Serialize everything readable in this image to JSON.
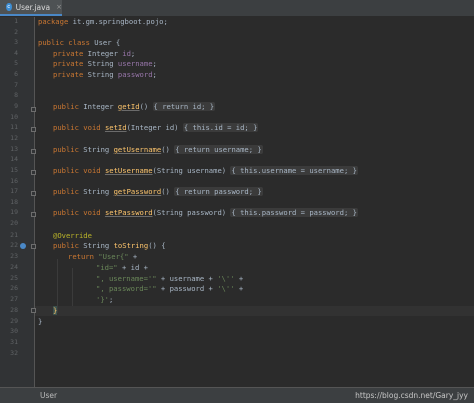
{
  "tab": {
    "label": "User.java",
    "icon": "c-class-icon",
    "close": "×"
  },
  "code": {
    "package": [
      "package",
      " it.gm.springboot.pojo;"
    ],
    "class_decl": [
      "public",
      " ",
      "class",
      " User {"
    ],
    "field1": [
      "private",
      " Integer ",
      "id",
      ";"
    ],
    "field2": [
      "private",
      " String ",
      "username",
      ";"
    ],
    "field3": [
      "private",
      " String ",
      "password",
      ";"
    ],
    "getId": [
      "public",
      " Integer ",
      "getId",
      "() ",
      "{ return id; }"
    ],
    "setId": [
      "public",
      " ",
      "void",
      " ",
      "setId",
      "(Integer id) ",
      "{ this.id = id; }"
    ],
    "getUsername": [
      "public",
      " String ",
      "getUsername",
      "() ",
      "{ return username; }"
    ],
    "setUsername": [
      "public",
      " ",
      "void",
      " ",
      "setUsername",
      "(String username) ",
      "{ this.username = username; }"
    ],
    "getPassword": [
      "public",
      " String ",
      "getPassword",
      "() ",
      "{ return password; }"
    ],
    "setPassword": [
      "public",
      " ",
      "void",
      " ",
      "setPassword",
      "(String password) ",
      "{ this.password = password; }"
    ],
    "override": "@Override",
    "toString_decl": [
      "public",
      " String ",
      "toString",
      "() {"
    ],
    "return_line": [
      "return",
      " ",
      "\"User{\"",
      " +"
    ],
    "concat1": [
      "\"id=\"",
      " + id +"
    ],
    "concat2": [
      "\", username='\"",
      " + username + ",
      "'\\''",
      " +"
    ],
    "concat3": [
      "\", password='\"",
      " + password + ",
      "'\\''",
      " +"
    ],
    "concat4": [
      "'}'",
      ";"
    ],
    "close_method": "}",
    "close_class": "}"
  },
  "line_numbers": [
    "1",
    "2",
    "3",
    "4",
    "5",
    "6",
    "7",
    "8",
    "9",
    "10",
    "11",
    "12",
    "13",
    "14",
    "15",
    "16",
    "17",
    "18",
    "19",
    "20",
    "21",
    "22",
    "23",
    "24",
    "25",
    "26",
    "27",
    "28",
    "29",
    "30",
    "31",
    "32"
  ],
  "status": {
    "left": "User",
    "watermark": "https://blog.csdn.net/Gary_jyy"
  }
}
